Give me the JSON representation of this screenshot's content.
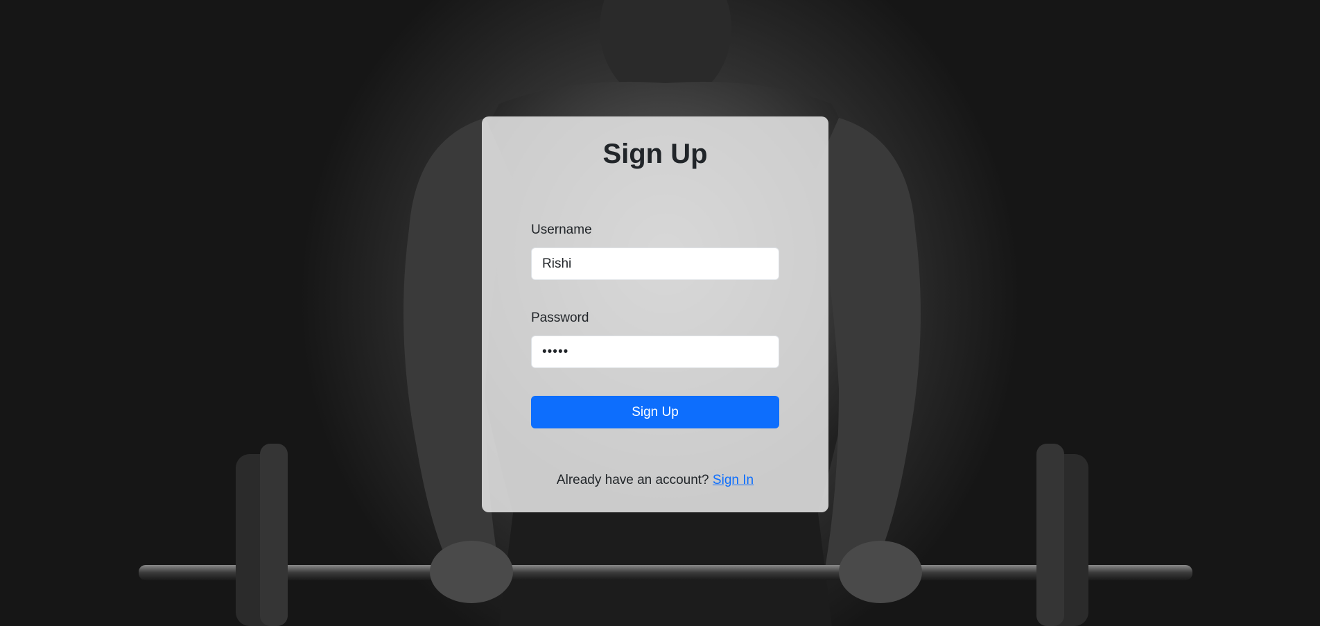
{
  "form": {
    "title": "Sign Up",
    "username_label": "Username",
    "username_value": "Rishi",
    "password_label": "Password",
    "password_value": "•••••",
    "submit_label": "Sign Up",
    "footer_text": "Already have an account?",
    "footer_link": "Sign In"
  },
  "colors": {
    "accent": "#0d6efd",
    "text": "#212529",
    "card_background": "#ececec"
  },
  "background": {
    "description_icon": "gym-athlete-photo"
  }
}
